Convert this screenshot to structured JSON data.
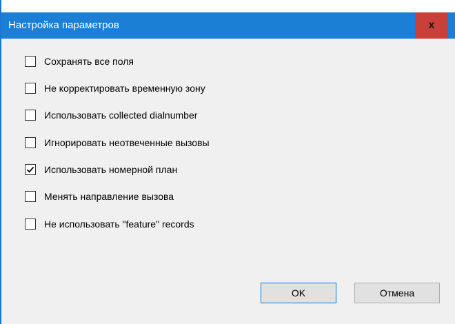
{
  "window": {
    "title": "Настройка параметров",
    "close_label": "x"
  },
  "options": [
    {
      "label": "Сохранять все поля",
      "checked": false
    },
    {
      "label": "Не корректировать временную зону",
      "checked": false
    },
    {
      "label": "Использовать collected dialnumber",
      "checked": false
    },
    {
      "label": "Игнорировать неотвеченные вызовы",
      "checked": false
    },
    {
      "label": "Использовать номерной план",
      "checked": true
    },
    {
      "label": "Менять направление вызова",
      "checked": false
    },
    {
      "label": "Не использовать \"feature\" records",
      "checked": false
    }
  ],
  "buttons": {
    "ok_label": "OK",
    "cancel_label": "Отмена"
  },
  "colors": {
    "titlebar": "#1b7fd6",
    "close_button": "#c9403a",
    "dialog_background": "#f0f0f0"
  }
}
